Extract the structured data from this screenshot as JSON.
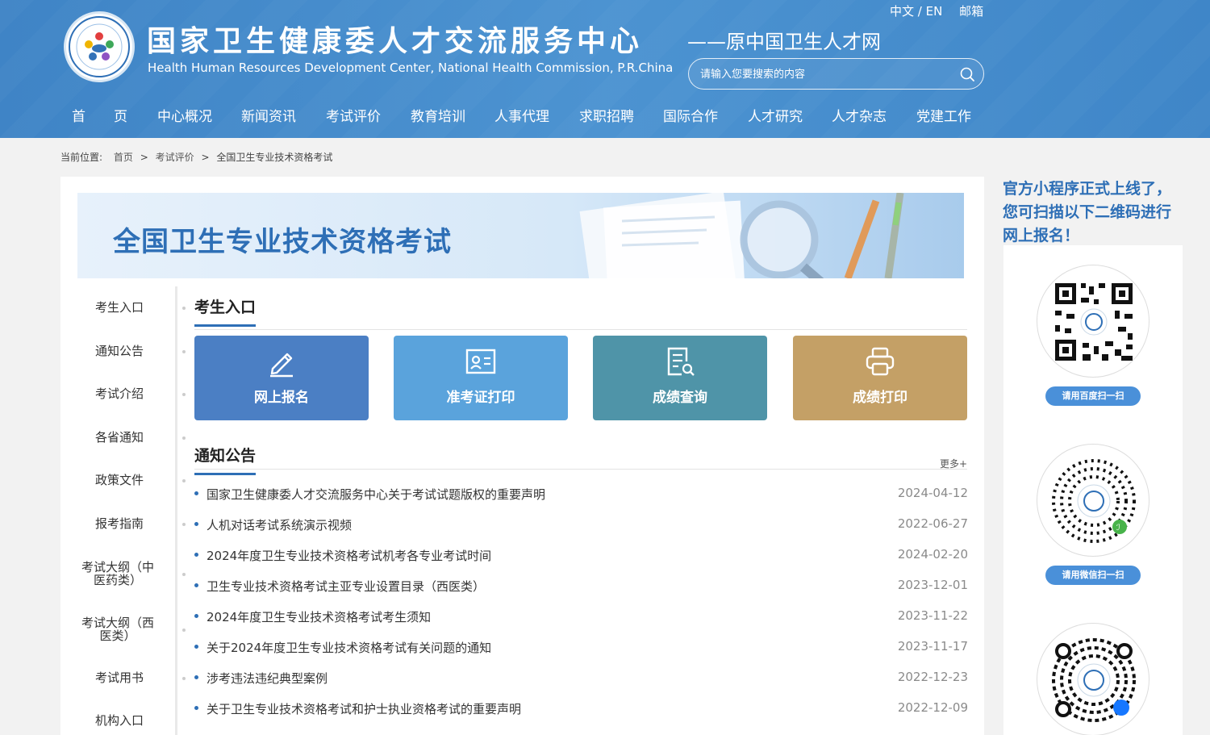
{
  "header": {
    "title_cn": "国家卫生健康委人才交流服务中心",
    "title_en": "Health Human Resources Development Center, National Health Commission, P.R.China",
    "subtitle": "——原中国卫生人才网",
    "lang_switch": "中文 / EN",
    "email": "邮箱",
    "search_placeholder": "请输入您要搜索的内容"
  },
  "nav": {
    "items": [
      {
        "label": "首"
      },
      {
        "label": "页"
      },
      {
        "label": "中心概况"
      },
      {
        "label": "新闻资讯"
      },
      {
        "label": "考试评价"
      },
      {
        "label": "教育培训"
      },
      {
        "label": "人事代理"
      },
      {
        "label": "求职招聘"
      },
      {
        "label": "国际合作"
      },
      {
        "label": "人才研究"
      },
      {
        "label": "人才杂志"
      },
      {
        "label": "党建工作"
      }
    ]
  },
  "breadcrumb": {
    "prefix": "当前位置:",
    "items": [
      "首页",
      "考试评价",
      "全国卫生专业技术资格考试"
    ],
    "separator": ">"
  },
  "banner": {
    "title": "全国卫生专业技术资格考试"
  },
  "sidebar": {
    "items": [
      {
        "label": "考生入口"
      },
      {
        "label": "通知公告"
      },
      {
        "label": "考试介绍"
      },
      {
        "label": "各省通知"
      },
      {
        "label": "政策文件"
      },
      {
        "label": "报考指南"
      },
      {
        "label": "考试大纲（中医药类）"
      },
      {
        "label": "考试大纲（西医类）"
      },
      {
        "label": "考试用书"
      },
      {
        "label": "机构入口"
      }
    ]
  },
  "entry": {
    "title": "考生入口",
    "tiles": [
      {
        "label": "网上报名",
        "icon": "pen-icon",
        "color": "#4b7fc4"
      },
      {
        "label": "准考证打印",
        "icon": "id-card-icon",
        "color": "#5aa3dc"
      },
      {
        "label": "成绩查询",
        "icon": "search-document-icon",
        "color": "#4f94a8"
      },
      {
        "label": "成绩打印",
        "icon": "printer-icon",
        "color": "#c4a066"
      }
    ]
  },
  "notices": {
    "title": "通知公告",
    "more": "更多+",
    "items": [
      {
        "title": "国家卫生健康委人才交流服务中心关于考试试题版权的重要声明",
        "date": "2024-04-12"
      },
      {
        "title": "人机对话考试系统演示视频",
        "date": "2022-06-27"
      },
      {
        "title": "2024年度卫生专业技术资格考试机考各专业考试时间",
        "date": "2024-02-20"
      },
      {
        "title": "卫生专业技术资格考试主亚专业设置目录（西医类）",
        "date": "2023-12-01"
      },
      {
        "title": "2024年度卫生专业技术资格考试考生须知",
        "date": "2023-11-22"
      },
      {
        "title": "关于2024年度卫生专业技术资格考试有关问题的通知",
        "date": "2023-11-17"
      },
      {
        "title": "涉考违法违纪典型案例",
        "date": "2022-12-23"
      },
      {
        "title": "关于卫生专业技术资格考试和护士执业资格考试的重要声明",
        "date": "2022-12-09"
      }
    ]
  },
  "promo": {
    "text": "官方小程序正式上线了，您可扫描以下二维码进行网上报名！",
    "qrs": [
      {
        "button": "请用百度扫一扫"
      },
      {
        "button": "请用微信扫一扫"
      },
      {
        "button": ""
      }
    ]
  },
  "colors": {
    "accent": "#2e6fb6",
    "header": "#4589cb"
  }
}
